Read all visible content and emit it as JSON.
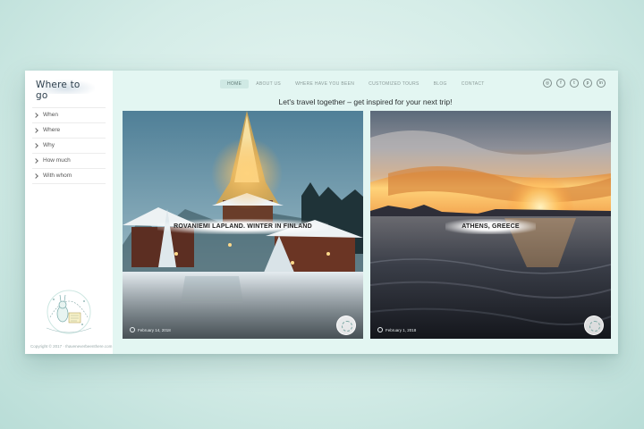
{
  "brand": {
    "logo_text": "Where to go"
  },
  "sidebar": {
    "items": [
      {
        "label": "When"
      },
      {
        "label": "Where"
      },
      {
        "label": "Why"
      },
      {
        "label": "How much"
      },
      {
        "label": "With whom"
      }
    ],
    "copyright": "Copyright © 2017 · Ihaveneverbeenthere.com"
  },
  "topnav": {
    "items": [
      {
        "label": "HOME"
      },
      {
        "label": "ABOUT US"
      },
      {
        "label": "WHERE HAVE YOU BEEN"
      },
      {
        "label": "CUSTOMIZED TOURS"
      },
      {
        "label": "BLOG"
      },
      {
        "label": "CONTACT"
      }
    ],
    "active_index": 0
  },
  "social": {
    "icons": [
      {
        "name": "instagram-icon",
        "glyph": "◎"
      },
      {
        "name": "facebook-icon",
        "glyph": "f"
      },
      {
        "name": "twitter-icon",
        "glyph": "t"
      },
      {
        "name": "pinterest-icon",
        "glyph": "p"
      },
      {
        "name": "linkedin-icon",
        "glyph": "in"
      }
    ]
  },
  "tagline": "Let's travel together – get inspired for your next trip!",
  "posts": [
    {
      "title": "ROVANIEMI LAPLAND. WINTER IN FINLAND",
      "date": "February 14, 2018"
    },
    {
      "title": "ATHENS, GREECE",
      "date": "February 1, 2018"
    }
  ],
  "colors": {
    "page_bg": "#d4ece7",
    "panel_bg": "#e3f6f2",
    "active_nav_bg": "#cfe9e4"
  }
}
